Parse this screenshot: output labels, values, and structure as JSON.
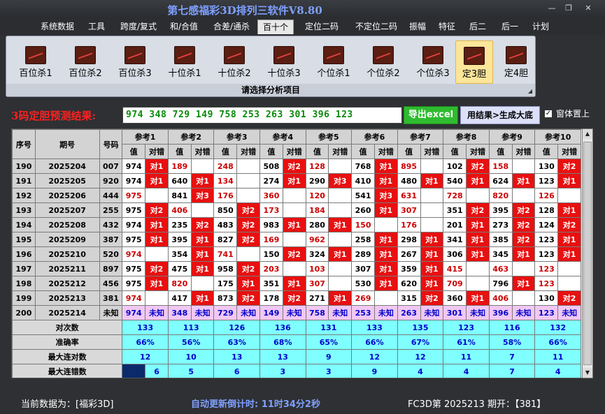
{
  "window": {
    "title": "第七感福彩3D排列三软件V8.80",
    "min": "—",
    "restore": "❐",
    "close": "✕"
  },
  "menu": [
    "系统数据",
    "工具",
    "跨度/复式",
    "和/合值",
    "合差/通杀",
    "百十个",
    "定位二码",
    "不定位二码",
    "振幅",
    "特征",
    "后二",
    "后一",
    "计划"
  ],
  "menu_active": 5,
  "tools": [
    {
      "label": "百位杀1"
    },
    {
      "label": "百位杀2"
    },
    {
      "label": "百位杀3"
    },
    {
      "label": "十位杀1"
    },
    {
      "label": "十位杀2"
    },
    {
      "label": "十位杀3"
    },
    {
      "label": "个位杀1"
    },
    {
      "label": "个位杀2"
    },
    {
      "label": "个位杀3"
    },
    {
      "label": "定3胆"
    },
    {
      "label": "定4胆"
    }
  ],
  "tools_selected": 9,
  "tool_caption": "请选择分析项目",
  "result": {
    "label": "3码定胆预测结果:",
    "value": "974 348 729 149 758 253 263 301 396 123",
    "excel_button": "导出excel",
    "gen_button": "用结果>生成大底",
    "ontop_label": "窗体置上",
    "ontop_checked": "✓"
  },
  "table": {
    "head_fixed": [
      "序号",
      "期号",
      "号码"
    ],
    "groups": [
      "参考1",
      "参考2",
      "参考3",
      "参考4",
      "参考5",
      "参考6",
      "参考7",
      "参考8",
      "参考9",
      "参考10"
    ],
    "sub": [
      "值",
      "对错"
    ],
    "rows": [
      {
        "seq": "190",
        "period": "2025204",
        "num": "007",
        "cells": [
          [
            "974",
            "k"
          ],
          [
            "对1",
            "r"
          ],
          [
            "189",
            "t"
          ],
          [
            "",
            ""
          ],
          [
            "248",
            "t"
          ],
          [
            "",
            ""
          ],
          [
            "508",
            "k"
          ],
          [
            "对2",
            "r"
          ],
          [
            "128",
            "t"
          ],
          [
            "",
            ""
          ],
          [
            "768",
            "k"
          ],
          [
            "对1",
            "r"
          ],
          [
            "895",
            "t"
          ],
          [
            "",
            ""
          ],
          [
            "102",
            "k"
          ],
          [
            "对2",
            "r"
          ],
          [
            "158",
            "t"
          ],
          [
            "",
            ""
          ],
          [
            "130",
            "k"
          ],
          [
            "对2",
            "r"
          ]
        ]
      },
      {
        "seq": "191",
        "period": "2025205",
        "num": "920",
        "cells": [
          [
            "974",
            "k"
          ],
          [
            "对1",
            "r"
          ],
          [
            "640",
            "k"
          ],
          [
            "对1",
            "r"
          ],
          [
            "134",
            "t"
          ],
          [
            "",
            ""
          ],
          [
            "274",
            "k"
          ],
          [
            "对1",
            "r"
          ],
          [
            "290",
            "k"
          ],
          [
            "对3",
            "r"
          ],
          [
            "410",
            "k"
          ],
          [
            "对1",
            "r"
          ],
          [
            "480",
            "k"
          ],
          [
            "对1",
            "r"
          ],
          [
            "540",
            "k"
          ],
          [
            "对1",
            "r"
          ],
          [
            "624",
            "k"
          ],
          [
            "对1",
            "r"
          ],
          [
            "123",
            "k"
          ],
          [
            "对1",
            "r"
          ]
        ]
      },
      {
        "seq": "192",
        "period": "2025206",
        "num": "444",
        "cells": [
          [
            "975",
            "t"
          ],
          [
            "",
            ""
          ],
          [
            "841",
            "k"
          ],
          [
            "对3",
            "r"
          ],
          [
            "176",
            "t"
          ],
          [
            "",
            ""
          ],
          [
            "360",
            "t"
          ],
          [
            "",
            ""
          ],
          [
            "120",
            "t"
          ],
          [
            "",
            ""
          ],
          [
            "541",
            "k"
          ],
          [
            "对3",
            "r"
          ],
          [
            "631",
            "t"
          ],
          [
            "",
            ""
          ],
          [
            "728",
            "t"
          ],
          [
            "",
            ""
          ],
          [
            "820",
            "t"
          ],
          [
            "",
            ""
          ],
          [
            "126",
            "t"
          ],
          [
            "",
            ""
          ]
        ]
      },
      {
        "seq": "193",
        "period": "2025207",
        "num": "255",
        "cells": [
          [
            "975",
            "k"
          ],
          [
            "对2",
            "r"
          ],
          [
            "406",
            "t"
          ],
          [
            "",
            ""
          ],
          [
            "850",
            "k"
          ],
          [
            "对2",
            "r"
          ],
          [
            "173",
            "t"
          ],
          [
            "",
            ""
          ],
          [
            "184",
            "t"
          ],
          [
            "",
            ""
          ],
          [
            "260",
            "k"
          ],
          [
            "对1",
            "r"
          ],
          [
            "307",
            "t"
          ],
          [
            "",
            ""
          ],
          [
            "351",
            "k"
          ],
          [
            "对2",
            "r"
          ],
          [
            "395",
            "k"
          ],
          [
            "对2",
            "r"
          ],
          [
            "128",
            "k"
          ],
          [
            "对1",
            "r"
          ]
        ]
      },
      {
        "seq": "194",
        "period": "2025208",
        "num": "432",
        "cells": [
          [
            "974",
            "k"
          ],
          [
            "对1",
            "r"
          ],
          [
            "235",
            "k"
          ],
          [
            "对2",
            "r"
          ],
          [
            "483",
            "k"
          ],
          [
            "对2",
            "r"
          ],
          [
            "983",
            "k"
          ],
          [
            "对1",
            "r"
          ],
          [
            "280",
            "k"
          ],
          [
            "对1",
            "r"
          ],
          [
            "150",
            "t"
          ],
          [
            "",
            ""
          ],
          [
            "176",
            "t"
          ],
          [
            "",
            ""
          ],
          [
            "201",
            "k"
          ],
          [
            "对1",
            "r"
          ],
          [
            "273",
            "k"
          ],
          [
            "对2",
            "r"
          ],
          [
            "124",
            "k"
          ],
          [
            "对2",
            "r"
          ]
        ]
      },
      {
        "seq": "195",
        "period": "2025209",
        "num": "387",
        "cells": [
          [
            "975",
            "k"
          ],
          [
            "对1",
            "r"
          ],
          [
            "395",
            "k"
          ],
          [
            "对1",
            "r"
          ],
          [
            "827",
            "k"
          ],
          [
            "对2",
            "r"
          ],
          [
            "169",
            "t"
          ],
          [
            "",
            ""
          ],
          [
            "962",
            "t"
          ],
          [
            "",
            ""
          ],
          [
            "258",
            "k"
          ],
          [
            "对1",
            "r"
          ],
          [
            "298",
            "k"
          ],
          [
            "对1",
            "r"
          ],
          [
            "341",
            "k"
          ],
          [
            "对1",
            "r"
          ],
          [
            "385",
            "k"
          ],
          [
            "对2",
            "r"
          ],
          [
            "123",
            "k"
          ],
          [
            "对1",
            "r"
          ]
        ]
      },
      {
        "seq": "196",
        "period": "2025210",
        "num": "520",
        "cells": [
          [
            "974",
            "t"
          ],
          [
            "",
            ""
          ],
          [
            "354",
            "k"
          ],
          [
            "对1",
            "r"
          ],
          [
            "741",
            "t"
          ],
          [
            "",
            ""
          ],
          [
            "150",
            "k"
          ],
          [
            "对2",
            "r"
          ],
          [
            "324",
            "k"
          ],
          [
            "对1",
            "r"
          ],
          [
            "289",
            "k"
          ],
          [
            "对1",
            "r"
          ],
          [
            "267",
            "k"
          ],
          [
            "对1",
            "r"
          ],
          [
            "306",
            "k"
          ],
          [
            "对1",
            "r"
          ],
          [
            "345",
            "k"
          ],
          [
            "对1",
            "r"
          ],
          [
            "123",
            "k"
          ],
          [
            "对1",
            "r"
          ]
        ]
      },
      {
        "seq": "197",
        "period": "2025211",
        "num": "897",
        "cells": [
          [
            "975",
            "k"
          ],
          [
            "对2",
            "r"
          ],
          [
            "475",
            "k"
          ],
          [
            "对1",
            "r"
          ],
          [
            "958",
            "k"
          ],
          [
            "对2",
            "r"
          ],
          [
            "203",
            "t"
          ],
          [
            "",
            ""
          ],
          [
            "103",
            "t"
          ],
          [
            "",
            ""
          ],
          [
            "307",
            "k"
          ],
          [
            "对1",
            "r"
          ],
          [
            "359",
            "k"
          ],
          [
            "对1",
            "r"
          ],
          [
            "415",
            "t"
          ],
          [
            "",
            ""
          ],
          [
            "463",
            "t"
          ],
          [
            "",
            ""
          ],
          [
            "123",
            "t"
          ],
          [
            "",
            ""
          ]
        ]
      },
      {
        "seq": "198",
        "period": "2025212",
        "num": "456",
        "cells": [
          [
            "975",
            "k"
          ],
          [
            "对1",
            "r"
          ],
          [
            "820",
            "t"
          ],
          [
            "",
            ""
          ],
          [
            "175",
            "k"
          ],
          [
            "对1",
            "r"
          ],
          [
            "351",
            "k"
          ],
          [
            "对1",
            "r"
          ],
          [
            "307",
            "t"
          ],
          [
            "",
            ""
          ],
          [
            "530",
            "k"
          ],
          [
            "对1",
            "r"
          ],
          [
            "620",
            "k"
          ],
          [
            "对1",
            "r"
          ],
          [
            "709",
            "t"
          ],
          [
            "",
            ""
          ],
          [
            "796",
            "k"
          ],
          [
            "对1",
            "r"
          ],
          [
            "123",
            "t"
          ],
          [
            "",
            ""
          ]
        ]
      },
      {
        "seq": "199",
        "period": "2025213",
        "num": "381",
        "cells": [
          [
            "974",
            "t"
          ],
          [
            "",
            ""
          ],
          [
            "417",
            "k"
          ],
          [
            "对1",
            "r"
          ],
          [
            "873",
            "k"
          ],
          [
            "对2",
            "r"
          ],
          [
            "178",
            "k"
          ],
          [
            "对2",
            "r"
          ],
          [
            "271",
            "k"
          ],
          [
            "对1",
            "r"
          ],
          [
            "269",
            "t"
          ],
          [
            "",
            ""
          ],
          [
            "315",
            "k"
          ],
          [
            "对2",
            "r"
          ],
          [
            "360",
            "k"
          ],
          [
            "对1",
            "r"
          ],
          [
            "406",
            "t"
          ],
          [
            "",
            ""
          ],
          [
            "130",
            "k"
          ],
          [
            "对2",
            "r"
          ]
        ]
      }
    ],
    "last": {
      "seq": "200",
      "period": "2025214",
      "num": "未知",
      "cells": [
        "974",
        "未知",
        "348",
        "未知",
        "729",
        "未知",
        "149",
        "未知",
        "758",
        "未知",
        "253",
        "未知",
        "263",
        "未知",
        "301",
        "未知",
        "396",
        "未知",
        "123",
        "未知"
      ]
    },
    "stats": [
      {
        "label": "对次数",
        "vals": [
          "133",
          "113",
          "126",
          "136",
          "131",
          "133",
          "135",
          "123",
          "116",
          "132"
        ]
      },
      {
        "label": "准确率",
        "vals": [
          "66%",
          "56%",
          "63%",
          "68%",
          "65%",
          "66%",
          "67%",
          "61%",
          "58%",
          "66%"
        ]
      },
      {
        "label": "最大连对数",
        "vals": [
          "12",
          "10",
          "13",
          "13",
          "9",
          "12",
          "12",
          "11",
          "7",
          "11"
        ]
      },
      {
        "label": "最大连错数",
        "vals": [
          "6",
          "5",
          "6",
          "3",
          "3",
          "9",
          "4",
          "4",
          "7",
          "4"
        ]
      }
    ]
  },
  "status": {
    "current": "当前数据为：[福彩3D]",
    "countdown": "自动更新倒计时:  11时34分2秒",
    "issue": "FC3D第 2025213 期开：【381】"
  },
  "colors": {
    "red": "#e81010",
    "cyan": "#7fffff",
    "pink": "#f1c8f3",
    "selected_tool": "#fbe59a",
    "green_button": "#2fbb2f"
  }
}
